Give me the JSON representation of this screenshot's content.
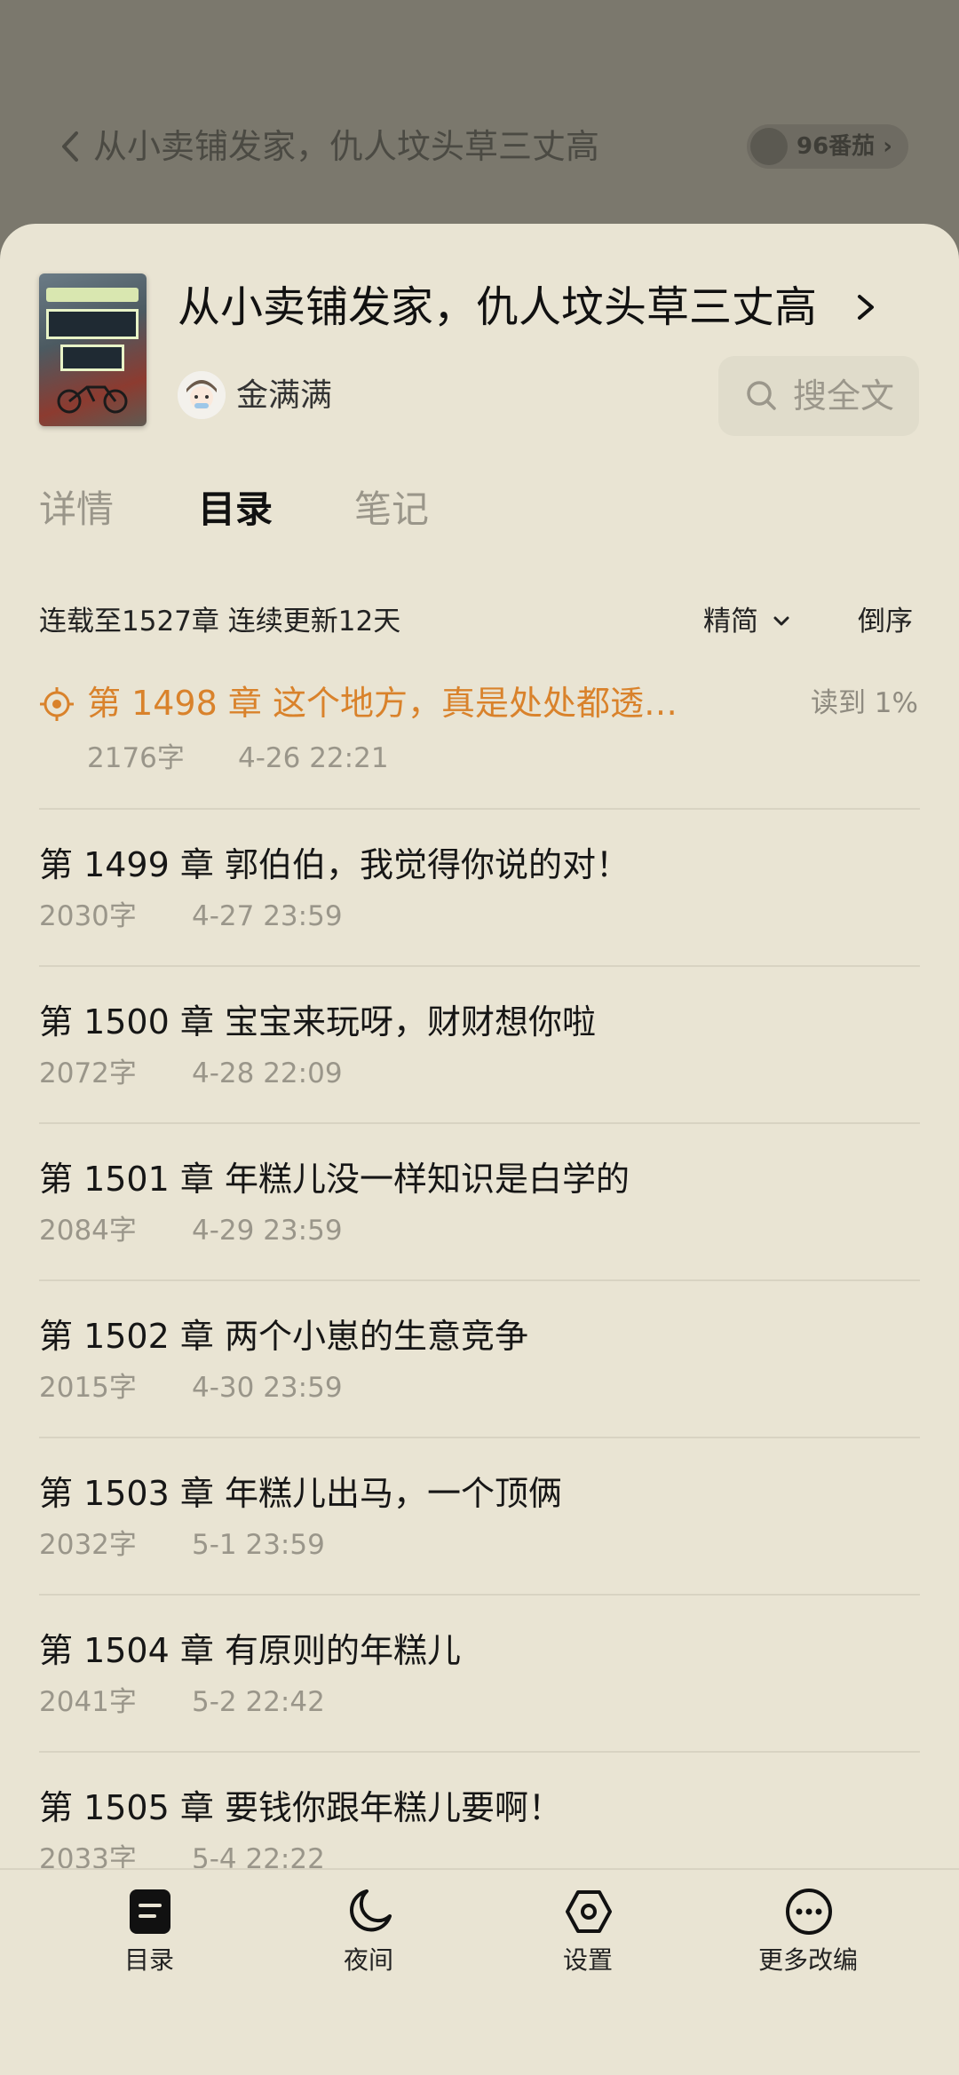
{
  "reader_header": {
    "title": "从小卖铺发家，仇人坟头草三丈高",
    "tomatoes": "96番茄",
    "tomatoes_arrow": "›"
  },
  "book": {
    "cover_text": "仇人坟头草三丈高",
    "title": "从小卖铺发家，仇人坟头草三丈高",
    "author": "金满满",
    "search_label": "搜全文"
  },
  "tabs": [
    {
      "label": "详情",
      "active": false
    },
    {
      "label": "目录",
      "active": true
    },
    {
      "label": "笔记",
      "active": false
    }
  ],
  "toc_meta": {
    "status": "连载至1527章 连续更新12天",
    "simp_label": "精简",
    "order_label": "倒序"
  },
  "current": {
    "title": "第 1498 章  这个地方，真是处处都透…",
    "progress": "读到 1%",
    "words": "2176字",
    "date": "4-26 22:21"
  },
  "chapters": [
    {
      "title": "第 1499 章  郭伯伯，我觉得你说的对！",
      "words": "2030字",
      "date": "4-27 23:59"
    },
    {
      "title": "第 1500 章  宝宝来玩呀，财财想你啦",
      "words": "2072字",
      "date": "4-28 22:09"
    },
    {
      "title": "第 1501 章  年糕儿没一样知识是白学的",
      "words": "2084字",
      "date": "4-29 23:59"
    },
    {
      "title": "第 1502 章  两个小崽的生意竞争",
      "words": "2015字",
      "date": "4-30 23:59"
    },
    {
      "title": "第 1503 章  年糕儿出马，一个顶俩",
      "words": "2032字",
      "date": "5-1 23:59"
    },
    {
      "title": "第 1504 章  有原则的年糕儿",
      "words": "2041字",
      "date": "5-2 22:42"
    },
    {
      "title": "第 1505 章  要钱你跟年糕儿要啊！",
      "words": "2033字",
      "date": "5-4 22:22"
    }
  ],
  "bottom_nav": [
    {
      "label": "目录",
      "icon": "toc-icon"
    },
    {
      "label": "夜间",
      "icon": "moon-icon"
    },
    {
      "label": "设置",
      "icon": "settings-icon"
    },
    {
      "label": "更多改编",
      "icon": "more-icon"
    }
  ],
  "colors": {
    "accent": "#d9822b",
    "sheet_bg": "#e9e4d3",
    "overlay_bg": "#7b786d"
  }
}
